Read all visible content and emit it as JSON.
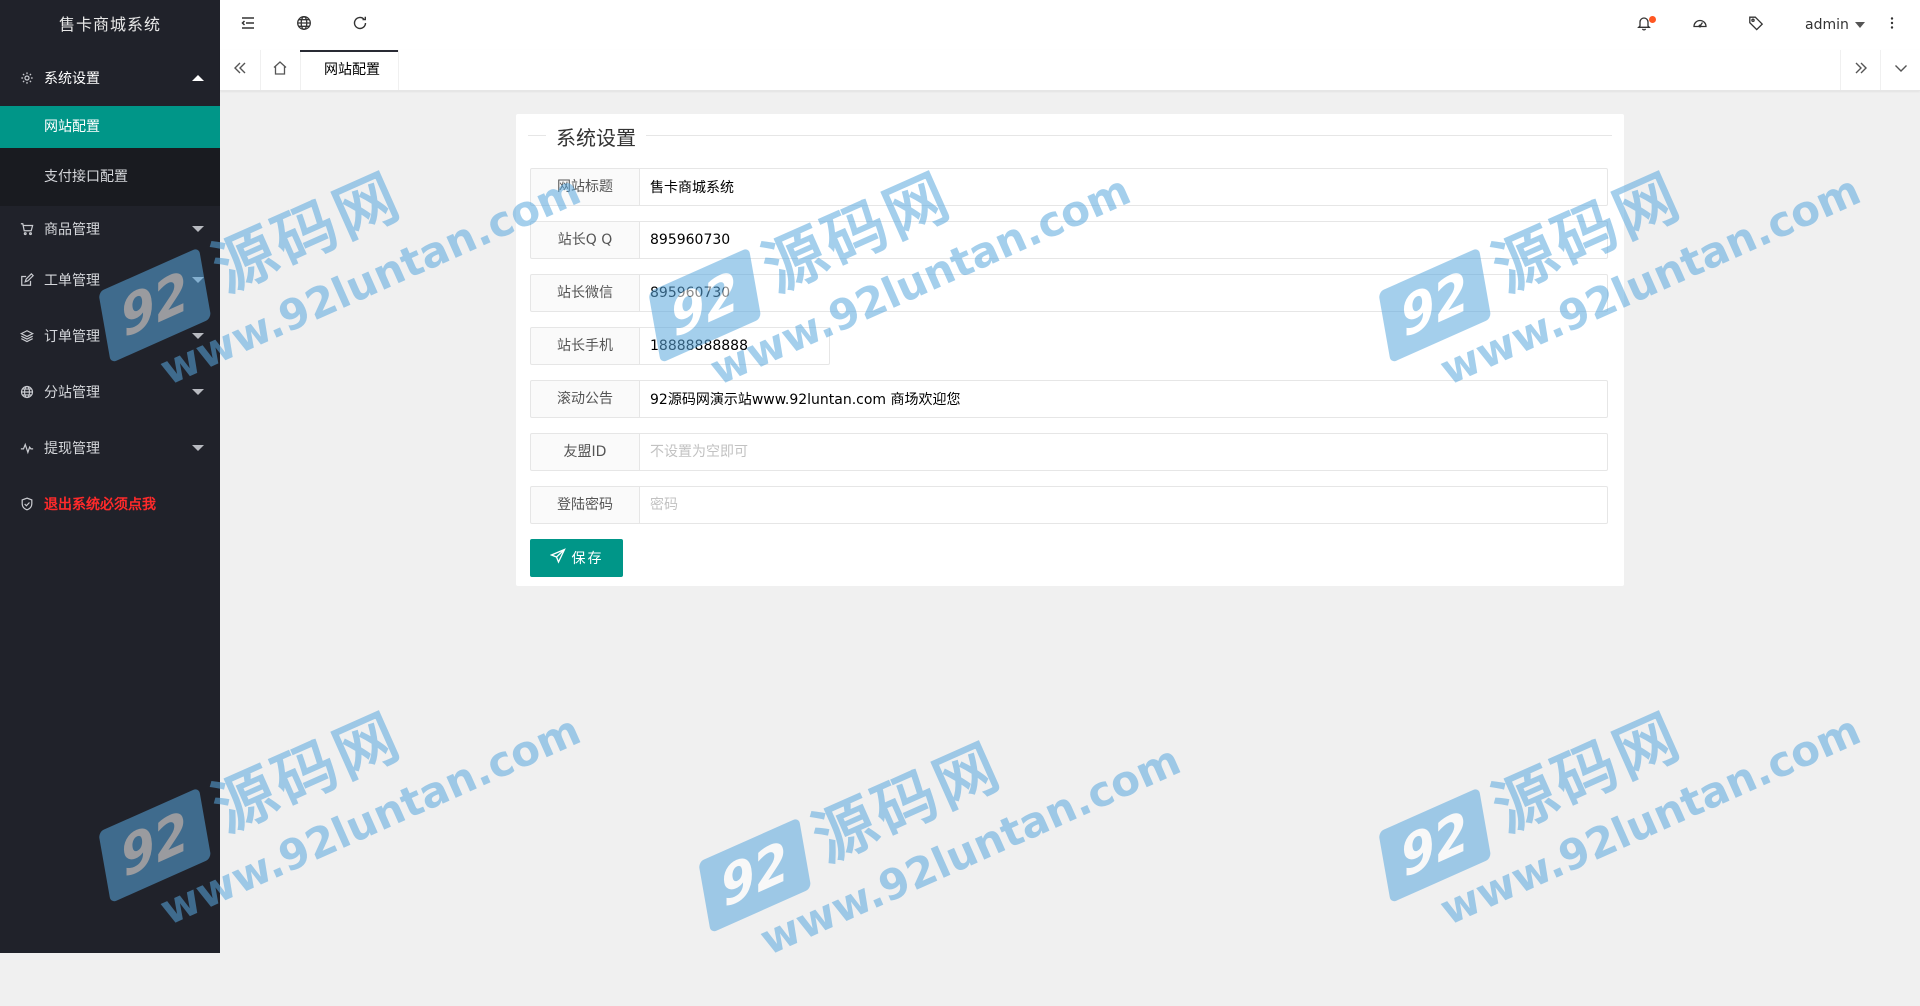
{
  "app": {
    "title": "售卡商城系统"
  },
  "sidebar": {
    "items": [
      {
        "label": "系统设置",
        "icon": "gear-icon",
        "expanded": true,
        "children": [
          {
            "label": "网站配置",
            "active": true
          },
          {
            "label": "支付接口配置",
            "active": false
          }
        ]
      },
      {
        "label": "商品管理",
        "icon": "cart-icon"
      },
      {
        "label": "工单管理",
        "icon": "edit-icon"
      },
      {
        "label": "订单管理",
        "icon": "layers-icon"
      },
      {
        "label": "分站管理",
        "icon": "globe-icon"
      },
      {
        "label": "提现管理",
        "icon": "pulse-icon"
      },
      {
        "label": "退出系统必须点我",
        "icon": "shield-icon",
        "color": "#ff2a2a"
      }
    ]
  },
  "header": {
    "icons": [
      "menu-fold-icon",
      "globe-icon",
      "refresh-icon",
      "bell-icon",
      "dashboard-icon",
      "tag-icon",
      "more-vertical-icon"
    ],
    "notification_dot_color": "#ff5722",
    "user": "admin"
  },
  "tabs": {
    "active_tab": "网站配置"
  },
  "form": {
    "legend": "系统设置",
    "fields": [
      {
        "label": "网站标题",
        "value": "售卡商城系统",
        "placeholder": ""
      },
      {
        "label": "站长Q Q",
        "value": "895960730",
        "placeholder": ""
      },
      {
        "label": "站长微信",
        "value": "895960730",
        "placeholder": ""
      },
      {
        "label": "站长手机",
        "value": "18888888888",
        "placeholder": ""
      },
      {
        "label": "滚动公告",
        "value": "92源码网演示站www.92luntan.com 商场欢迎您",
        "placeholder": ""
      },
      {
        "label": "友盟ID",
        "value": "",
        "placeholder": "不设置为空即可"
      },
      {
        "label": "登陆密码",
        "value": "",
        "placeholder": "密码"
      }
    ],
    "save_label": "保存"
  },
  "watermark": {
    "badge": "92",
    "chinese": "源码网",
    "url": "www.92luntan.com"
  },
  "colors": {
    "accent": "#009688",
    "sidebar_bg": "#20222a",
    "danger": "#ff2a2a",
    "watermark": "#5aa8de"
  }
}
